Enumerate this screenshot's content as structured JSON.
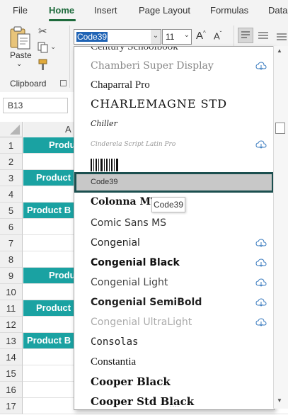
{
  "ribbon": {
    "tabs": [
      "File",
      "Home",
      "Insert",
      "Page Layout",
      "Formulas",
      "Data"
    ],
    "active_tab": "Home",
    "paste_label": "Paste",
    "clipboard_label": "Clipboard",
    "font_name_value": "Code39",
    "font_size_value": "11"
  },
  "formula_bar": {
    "name_box": "B13"
  },
  "sheet": {
    "column_label": "A",
    "rows": [
      "1",
      "2",
      "3",
      "4",
      "5",
      "6",
      "7",
      "8",
      "9",
      "10",
      "11",
      "12",
      "13",
      "14",
      "15",
      "16",
      "17"
    ],
    "teal_cells": {
      "r1": "Produ",
      "r3": "Product",
      "r5": "Product B",
      "r9": "Produ",
      "r11": "Product",
      "r13": "Product B"
    }
  },
  "font_list": {
    "items": [
      {
        "name": "Century Schoolbook",
        "cloud": false
      },
      {
        "name": "Chamberi Super Display",
        "cloud": true
      },
      {
        "name": "Chaparral Pro",
        "cloud": false
      },
      {
        "name": "CHARLEMAGNE STD",
        "cloud": false
      },
      {
        "name": "Chiller",
        "cloud": false
      },
      {
        "name": "Cinderela Script Latin Pro",
        "cloud": true
      },
      {
        "name": "Code39 preview",
        "cloud": false
      },
      {
        "name": "Code39",
        "cloud": false
      },
      {
        "name": "Colonna MT",
        "cloud": false
      },
      {
        "name": "Comic Sans MS",
        "cloud": false
      },
      {
        "name": "Congenial",
        "cloud": true
      },
      {
        "name": "Congenial Black",
        "cloud": true
      },
      {
        "name": "Congenial Light",
        "cloud": true
      },
      {
        "name": "Congenial SemiBold",
        "cloud": true
      },
      {
        "name": "Congenial UltraLight",
        "cloud": true
      },
      {
        "name": "Consolas",
        "cloud": false
      },
      {
        "name": "Constantia",
        "cloud": false
      },
      {
        "name": "Cooper Black",
        "cloud": false
      },
      {
        "name": "Cooper Std Black",
        "cloud": false
      }
    ],
    "tooltip": "Code39"
  },
  "colors": {
    "accent": "#1e6b3c",
    "teal": "#1aa2a2",
    "highlight": "#c8c8c8",
    "highlight_border": "#1b4f4f"
  }
}
